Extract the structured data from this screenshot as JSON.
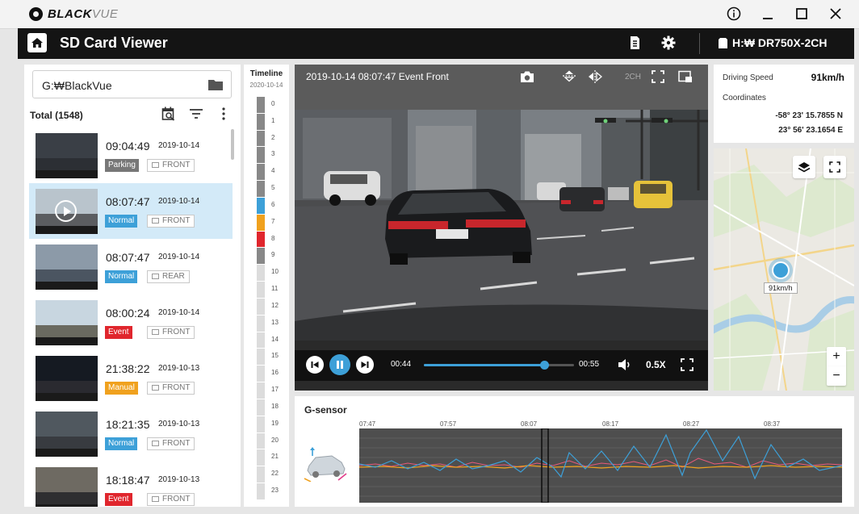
{
  "app": {
    "logo_main": "BLACK",
    "logo_accent": "VUE",
    "title": "SD Card Viewer",
    "device": "H:₩ DR750X-2CH",
    "window_controls": [
      "info-icon",
      "minimize-icon",
      "maximize-icon",
      "close-icon"
    ]
  },
  "left": {
    "path": "G:₩BlackVue",
    "total": "Total (1548)",
    "files": [
      {
        "time": "09:04:49",
        "date": "2019-10-14",
        "mode": "Parking",
        "cam": "FRONT",
        "selected": false,
        "scene": "garage"
      },
      {
        "time": "08:07:47",
        "date": "2019-10-14",
        "mode": "Normal",
        "cam": "FRONT",
        "selected": true,
        "scene": "road"
      },
      {
        "time": "08:07:47",
        "date": "2019-10-14",
        "mode": "Normal",
        "cam": "REAR",
        "selected": false,
        "scene": "rear"
      },
      {
        "time": "08:00:24",
        "date": "2019-10-14",
        "mode": "Event",
        "cam": "FRONT",
        "selected": false,
        "scene": "day"
      },
      {
        "time": "21:38:22",
        "date": "2019-10-13",
        "mode": "Manual",
        "cam": "FRONT",
        "selected": false,
        "scene": "night"
      },
      {
        "time": "18:21:35",
        "date": "2019-10-13",
        "mode": "Normal",
        "cam": "FRONT",
        "selected": false,
        "scene": "city"
      },
      {
        "time": "18:18:47",
        "date": "2019-10-13",
        "mode": "Event",
        "cam": "FRONT",
        "selected": false,
        "scene": "tunnel"
      }
    ]
  },
  "timeline": {
    "title": "Timeline",
    "date": "2020-10-14",
    "hours": [
      {
        "h": "0",
        "fill": "#888888"
      },
      {
        "h": "1",
        "fill": "#888888"
      },
      {
        "h": "2",
        "fill": "#888888"
      },
      {
        "h": "3",
        "fill": "#888888"
      },
      {
        "h": "4",
        "fill": "#888888"
      },
      {
        "h": "5",
        "fill": "#888888"
      },
      {
        "h": "6",
        "fill": "#3da0d8"
      },
      {
        "h": "7",
        "fill": "#f0a11e"
      },
      {
        "h": "8",
        "fill": "#e0262d"
      },
      {
        "h": "9",
        "fill": "#888888"
      },
      {
        "h": "10",
        "fill": "#dcdcdc"
      },
      {
        "h": "11",
        "fill": "#dcdcdc"
      },
      {
        "h": "12",
        "fill": "#dcdcdc"
      },
      {
        "h": "13",
        "fill": "#dcdcdc"
      },
      {
        "h": "14",
        "fill": "#dcdcdc"
      },
      {
        "h": "15",
        "fill": "#dcdcdc"
      },
      {
        "h": "16",
        "fill": "#dcdcdc"
      },
      {
        "h": "17",
        "fill": "#dcdcdc"
      },
      {
        "h": "18",
        "fill": "#dcdcdc"
      },
      {
        "h": "19",
        "fill": "#dcdcdc"
      },
      {
        "h": "20",
        "fill": "#dcdcdc"
      },
      {
        "h": "21",
        "fill": "#dcdcdc"
      },
      {
        "h": "22",
        "fill": "#dcdcdc"
      },
      {
        "h": "23",
        "fill": "#dcdcdc"
      }
    ]
  },
  "video": {
    "title": "2019-10-14 08:07:47 Event Front",
    "channel": "2CH",
    "current_time": "00:44",
    "total_time": "00:55",
    "progress": 0.8,
    "speed": "0.5X"
  },
  "info": {
    "speed_label": "Driving Speed",
    "speed_value": "91km/h",
    "coord_label": "Coordinates",
    "lat": "-58° 23'  15.7855 N",
    "lon": "23° 56'  23.1654 E"
  },
  "map": {
    "speed_label": "91km/h",
    "zoom_in": "+",
    "zoom_out": "−"
  },
  "gsensor": {
    "title": "G-sensor",
    "ticks": [
      "07:47",
      "07:57",
      "08:07",
      "08:17",
      "08:27",
      "08:37"
    ]
  },
  "colors": {
    "accent": "#3da0d8",
    "event": "#e0262d",
    "manual": "#f0a11e",
    "parking": "#777777"
  }
}
